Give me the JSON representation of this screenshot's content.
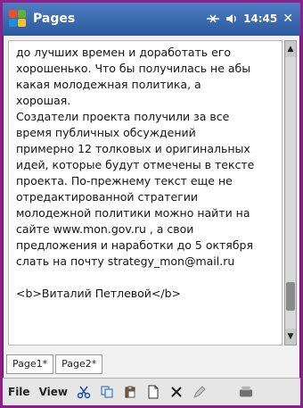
{
  "window": {
    "title": "Pages",
    "status": {
      "time": "14:45"
    }
  },
  "content": {
    "lines": [
      "до лучших времен и доработать его",
      "хорошенько. Что бы получилась не абы",
      "какая молодежная политика, а",
      "хорошая.",
      "Создатели проекта получили за все",
      "время публичных обсуждений",
      "примерно 12 толковых и оригинальных",
      "идей, которые будут отмечены в тексте",
      "проекта. По-прежнему текст еще не",
      "отредактированной стратегии",
      "молодежной политики можно найти на",
      "сайте www.mon.gov.ru , а свои",
      "предложения и наработки до 5 октября",
      "слать на почту strategy_mon@mail.ru",
      "",
      "<b>Виталий Петлевой</b>"
    ]
  },
  "tabs": [
    {
      "label": "Page1*"
    },
    {
      "label": "Page2*"
    }
  ],
  "toolbar": {
    "menus": [
      "File",
      "View"
    ]
  },
  "colors": {
    "border_bg": "#8e1f8a",
    "title_bg": "#2a5a9d"
  }
}
